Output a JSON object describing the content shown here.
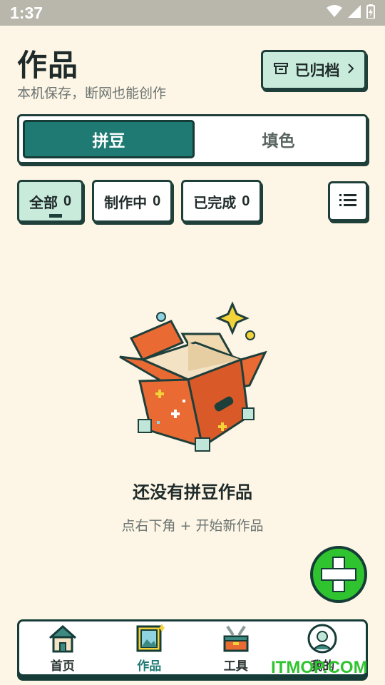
{
  "status_bar": {
    "time": "1:37",
    "icons": [
      "wifi-icon",
      "signal-icon",
      "battery-icon"
    ]
  },
  "header": {
    "title": "作品",
    "subtitle": "本机保存，断网也能创作",
    "archive_button": {
      "label": "已归档",
      "icon": "archive-icon",
      "trailing_icon": "chevron-right-icon"
    }
  },
  "segmented": {
    "tabs": [
      {
        "label": "拼豆",
        "active": true
      },
      {
        "label": "填色",
        "active": false
      }
    ]
  },
  "filters": {
    "chips": [
      {
        "label": "全部",
        "count": "0",
        "active": true
      },
      {
        "label": "制作中",
        "count": "0",
        "active": false
      },
      {
        "label": "已完成",
        "count": "0",
        "active": false
      }
    ],
    "view_toggle_icon": "list-icon"
  },
  "empty_state": {
    "illustration": "open-box-icon",
    "title": "还没有拼豆作品",
    "hint": "点右下角 + 开始新作品"
  },
  "fab": {
    "icon": "plus-icon"
  },
  "bottom_nav": {
    "items": [
      {
        "label": "首页",
        "icon": "house-icon",
        "active": false
      },
      {
        "label": "作品",
        "icon": "picture-frame-icon",
        "active": true
      },
      {
        "label": "工具",
        "icon": "toolbox-icon",
        "active": false
      },
      {
        "label": "我的",
        "icon": "avatar-icon",
        "active": false
      }
    ]
  },
  "watermark": "ITMOP.COM",
  "colors": {
    "background": "#fdf6e6",
    "primary": "#1f7a73",
    "outline": "#1f3f3a",
    "accent_mint": "#c8ebdc",
    "fab_green": "#2fc42f",
    "box_orange": "#ea6a34"
  }
}
